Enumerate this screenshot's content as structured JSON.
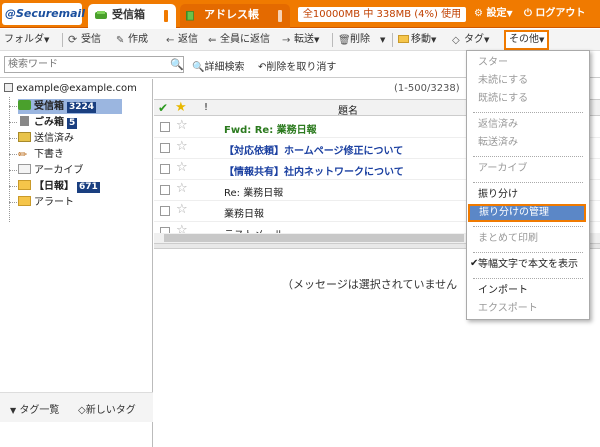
{
  "header": {
    "logo": "@Securemail",
    "tabs": [
      {
        "label": "受信箱"
      },
      {
        "label": "アドレス帳"
      }
    ],
    "quota": "全10000MB 中 338MB (4%) 使用",
    "settings": "設定",
    "logout": "ログアウト"
  },
  "toolbar": {
    "folder": "フォルダ",
    "receive": "受信",
    "compose": "作成",
    "reply": "返信",
    "reply_all": "全員に返信",
    "forward": "転送",
    "delete": "削除",
    "move": "移動",
    "tag": "タグ",
    "other": "その他"
  },
  "search": {
    "placeholder": "検索ワード",
    "advanced": "詳細検索",
    "cancel": "削除を取り消す"
  },
  "sidebar": {
    "account": "example@example.com",
    "folders": [
      {
        "label": "受信箱",
        "count": "3224"
      },
      {
        "label": "ごみ箱",
        "count": "5"
      },
      {
        "label": "送信済み"
      },
      {
        "label": "下書き"
      },
      {
        "label": "アーカイブ"
      },
      {
        "label": "【日報】",
        "count": "671"
      },
      {
        "label": "アラート"
      }
    ],
    "tag_list": "タグ一覧",
    "new_tag": "新しいタグ"
  },
  "list": {
    "paging": "(1-500/3238)",
    "col_flag": "!",
    "col_subject": "題名",
    "rows": [
      {
        "subject": "Fwd: Re: 業務日報",
        "color": "#2b7a1e",
        "bold": true
      },
      {
        "subject": "【対応依頼】ホームページ修正について",
        "color": "#1a3fa0",
        "bold": true
      },
      {
        "subject": "【情報共有】社内ネットワークについて",
        "color": "#1a3fa0",
        "bold": true
      },
      {
        "subject": "Re: 業務日報",
        "color": "#222222",
        "bold": false
      },
      {
        "subject": "業務日報",
        "color": "#222222",
        "bold": false
      },
      {
        "subject": "テストメール",
        "color": "#222222",
        "bold": false
      }
    ],
    "no_message": "（メッセージは選択されていません"
  },
  "menu": {
    "items": [
      {
        "label": "スター",
        "enabled": false
      },
      {
        "label": "未読にする",
        "enabled": false
      },
      {
        "label": "既読にする",
        "enabled": false
      },
      {
        "label": "返信済み",
        "enabled": false
      },
      {
        "label": "転送済み",
        "enabled": false
      },
      {
        "label": "アーカイブ",
        "enabled": false
      },
      {
        "label": "振り分け",
        "enabled": true
      },
      {
        "label": "振り分けの管理",
        "enabled": true,
        "highlighted": true
      },
      {
        "label": "まとめて印刷",
        "enabled": false
      },
      {
        "label": "等幅文字で本文を表示",
        "enabled": true,
        "checked": true
      },
      {
        "label": "インポート",
        "enabled": true
      },
      {
        "label": "エクスポート",
        "enabled": false
      }
    ]
  },
  "colors": {
    "brand": "#f07a00",
    "selection": "#9bb6e0",
    "menu_highlight": "#5b87c7"
  }
}
